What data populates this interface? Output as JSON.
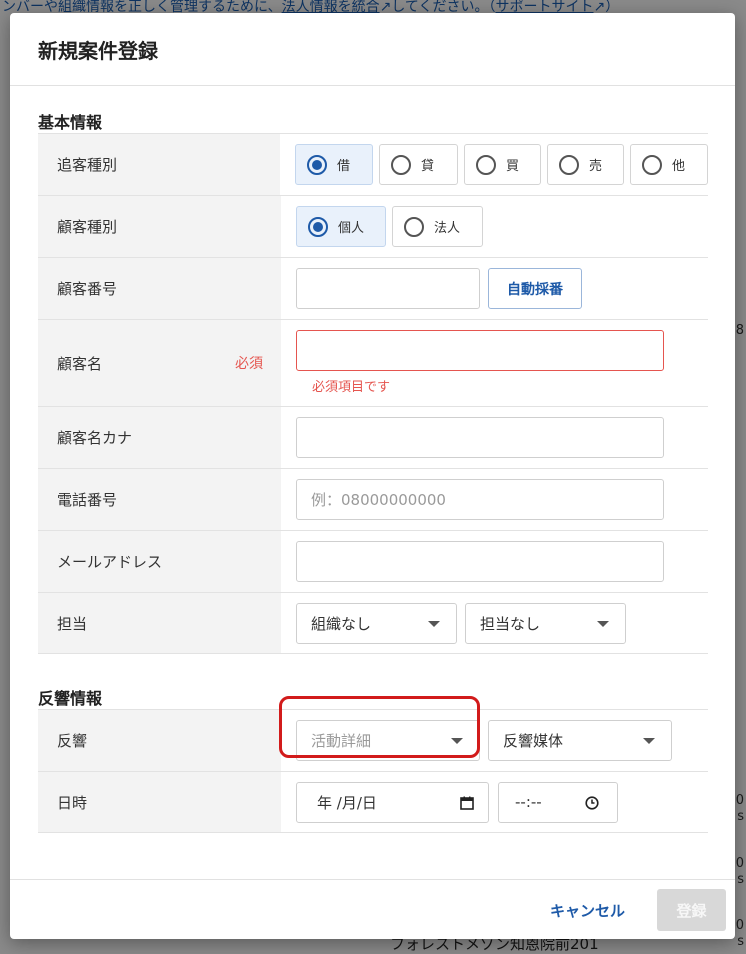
{
  "background": {
    "banner_prefix": "ンバーや組織情報を正しく管理するために、",
    "banner_link1": "法人情報を統合",
    "banner_mid": "してください。（",
    "banner_link2": "サポートサイト",
    "banner_suffix": "）",
    "bottom_text": "フォレストメゾン知恩院前201",
    "right_fragments": [
      ".8",
      "0",
      "s",
      "0",
      "s",
      "0",
      "s"
    ]
  },
  "modal": {
    "title": "新規案件登録",
    "sections": {
      "basic": "基本情報",
      "response": "反響情報"
    },
    "fields": {
      "tsuikyaku_label": "追客種別",
      "tsuikyaku_options": [
        "借",
        "貸",
        "買",
        "売",
        "他"
      ],
      "tsuikyaku_selected": "借",
      "customer_type_label": "顧客種別",
      "customer_type_options": [
        "個人",
        "法人"
      ],
      "customer_type_selected": "個人",
      "customer_no_label": "顧客番号",
      "customer_no_value": "",
      "auto_number_button": "自動採番",
      "customer_name_label": "顧客名",
      "required_badge": "必須",
      "customer_name_value": "",
      "customer_name_error": "必須項目です",
      "customer_kana_label": "顧客名カナ",
      "customer_kana_value": "",
      "phone_label": "電話番号",
      "phone_placeholder": "例：08000000000",
      "email_label": "メールアドレス",
      "email_value": "",
      "assignee_label": "担当",
      "org_select": "組織なし",
      "person_select": "担当なし",
      "response_label": "反響",
      "activity_detail_placeholder": "活動詳細",
      "response_media_select": "反響媒体",
      "datetime_label": "日時",
      "date_value": "年 /月/日",
      "time_value": "--:--"
    },
    "footer": {
      "cancel": "キャンセル",
      "submit": "登録"
    }
  },
  "colors": {
    "accent": "#1e5aa8",
    "error": "#e5554f",
    "highlight": "#d21b1b",
    "label_bg": "#f3f3f3"
  }
}
